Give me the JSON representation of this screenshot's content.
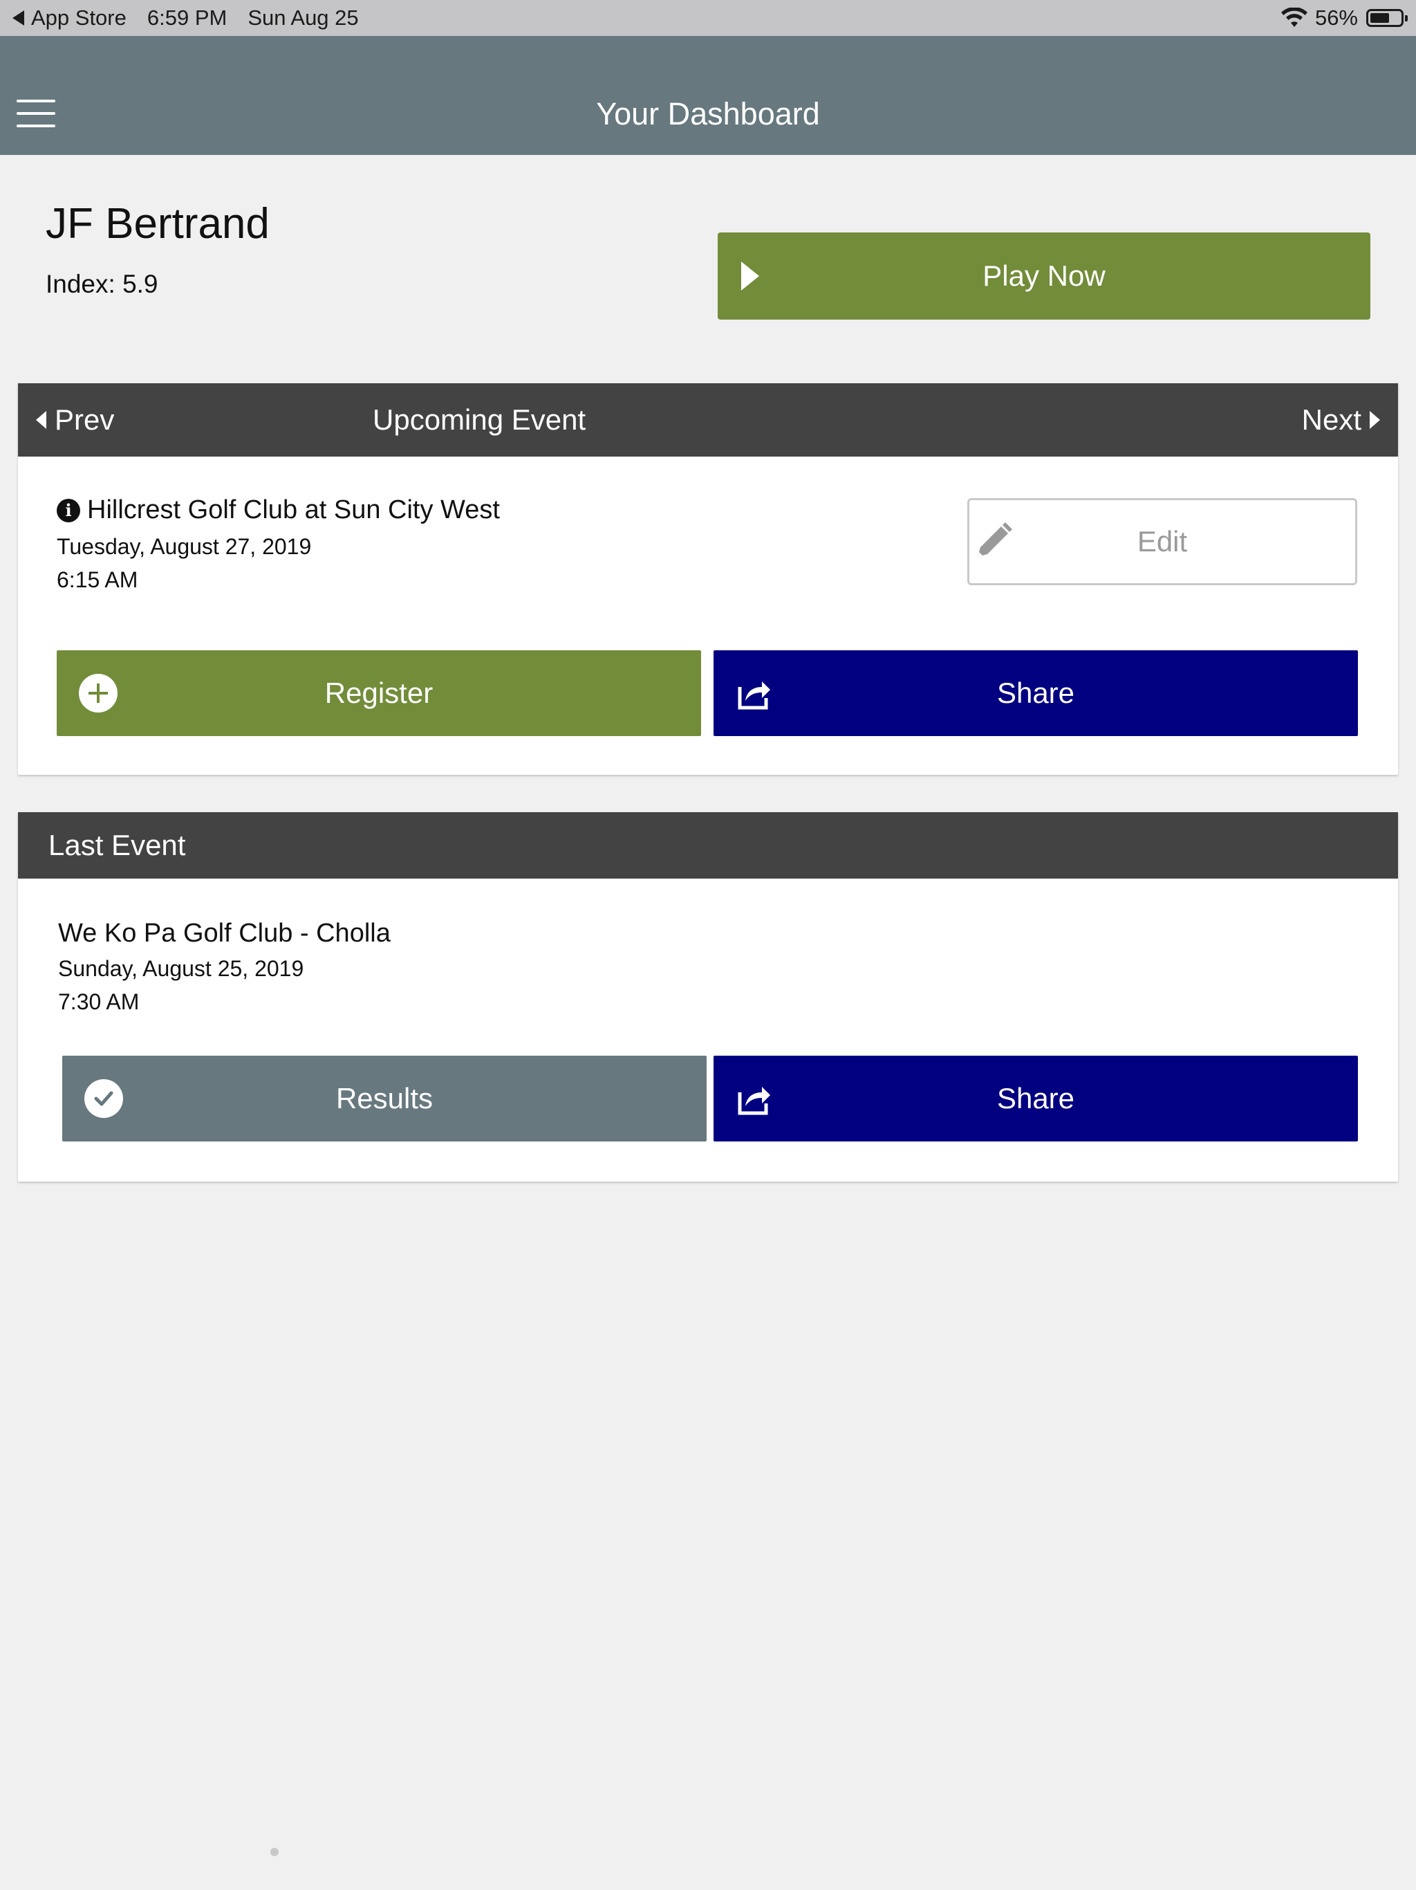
{
  "status_bar": {
    "back_app": "App Store",
    "time": "6:59 PM",
    "date": "Sun Aug 25",
    "battery": "56%"
  },
  "header": {
    "title": "Your Dashboard"
  },
  "profile": {
    "name": "JF Bertrand",
    "index": "Index: 5.9"
  },
  "play_now_label": "Play Now",
  "upcoming_event": {
    "section_title": "Upcoming Event",
    "prev_label": "Prev",
    "next_label": "Next",
    "course": "Hillcrest Golf Club at Sun City West",
    "date": "Tuesday, August 27, 2019",
    "time": "6:15 AM",
    "edit_label": "Edit",
    "register_label": "Register",
    "share_label": "Share"
  },
  "last_event": {
    "section_title": "Last Event",
    "course": "We Ko Pa Golf Club - Cholla",
    "date": "Sunday, August 25, 2019",
    "time": "7:30 AM",
    "results_label": "Results",
    "share_label": "Share"
  },
  "colors": {
    "header": "#67787f",
    "card_header": "#434343",
    "green": "#728c3a",
    "navy": "#000080",
    "background": "#f0f0f0"
  },
  "icons": [
    "back-arrow-icon",
    "wifi-icon",
    "battery-icon",
    "menu-icon",
    "play-icon",
    "chevron-left-icon",
    "chevron-right-icon",
    "info-icon",
    "pencil-icon",
    "plus-circle-icon",
    "share-icon",
    "check-circle-icon"
  ]
}
